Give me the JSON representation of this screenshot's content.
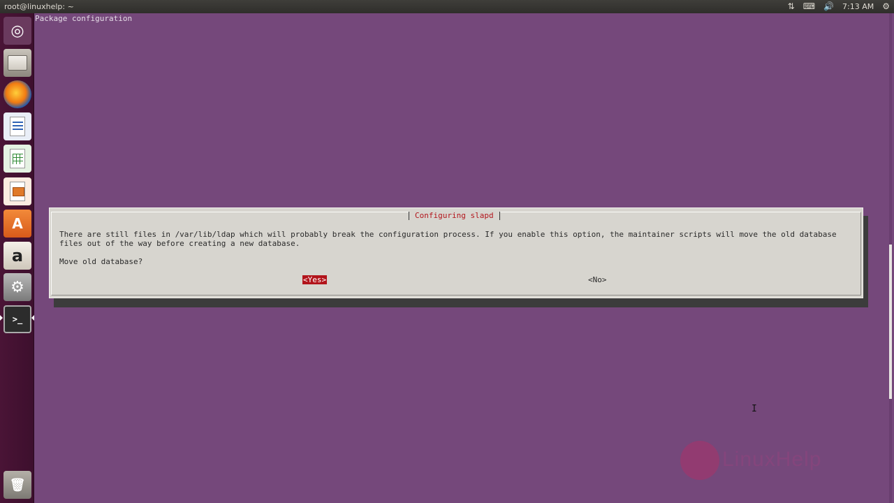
{
  "panel": {
    "window_title": "root@linuxhelp: ~",
    "clock": "7:13 AM"
  },
  "launcher": {
    "items": [
      "dash-home",
      "files",
      "firefox",
      "libreoffice-writer",
      "libreoffice-calc",
      "libreoffice-impress",
      "ubuntu-software",
      "amazon",
      "system-settings",
      "terminal",
      "trash"
    ],
    "active": "terminal"
  },
  "terminal": {
    "header": "Package configuration",
    "scroll_position": 0.69
  },
  "dialog": {
    "title": "Configuring slapd",
    "message_line1": "There are still files in /var/lib/ldap which will probably break the configuration process. If you enable this option, the maintainer scripts will move the old database",
    "message_line2": "files out of the way before creating a new database.",
    "question": "Move old database?",
    "yes_label": "<Yes>",
    "no_label": "<No>",
    "selected": "yes"
  },
  "watermark": {
    "text": "LinuxHelp"
  },
  "colors": {
    "terminal_bg": "#75487b",
    "dialog_bg": "#d7d5cf",
    "accent_red": "#b2141b"
  }
}
